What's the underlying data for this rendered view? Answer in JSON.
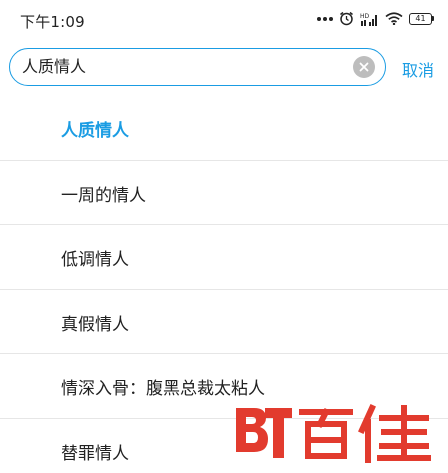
{
  "status_bar": {
    "time": "下午1:09",
    "battery_level": "41",
    "icons": [
      "more-dots-icon",
      "alarm-icon",
      "signal-icon",
      "wifi-icon",
      "battery-icon"
    ]
  },
  "search": {
    "value": "人质情人",
    "cancel_label": "取消"
  },
  "suggestions": [
    {
      "label": "人质情人",
      "active": true
    },
    {
      "label": "一周的情人",
      "active": false
    },
    {
      "label": "低调情人",
      "active": false
    },
    {
      "label": "真假情人",
      "active": false
    },
    {
      "label": "情深入骨：腹黑总裁太粘人",
      "active": false
    },
    {
      "label": "替罪情人",
      "active": false
    }
  ],
  "watermark": {
    "logo_text": "百佳",
    "mark": "BT"
  },
  "colors": {
    "accent": "#1a9ce3",
    "watermark_red": "#e23b2e"
  }
}
